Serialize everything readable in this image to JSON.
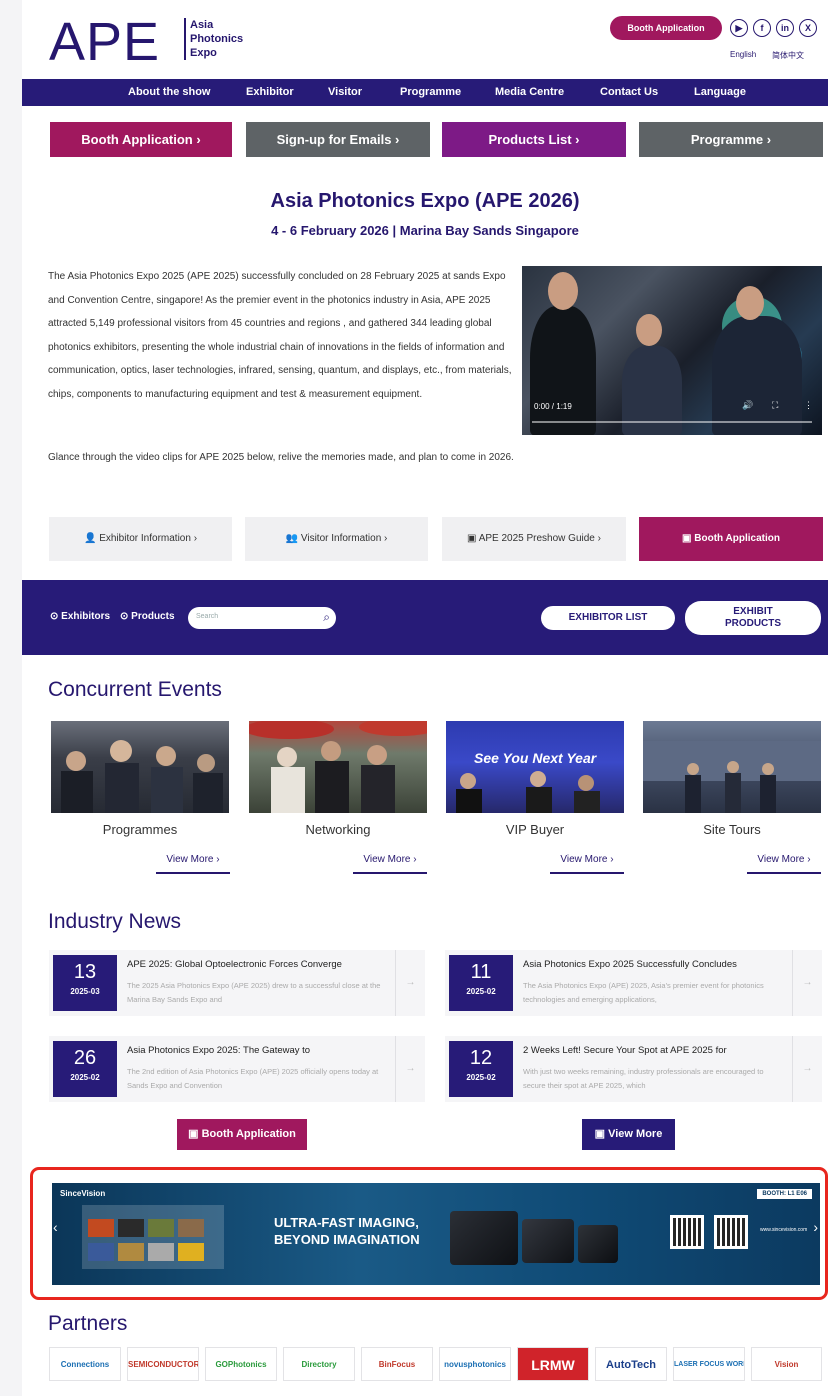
{
  "header": {
    "logo_text": "APE",
    "logo_sub": [
      "Asia",
      "Photonics",
      "Expo"
    ],
    "booth_button": "Booth Application",
    "social_icons": [
      "youtube-icon",
      "facebook-icon",
      "linkedin-icon",
      "x-icon"
    ],
    "languages": [
      "English",
      "简体中文"
    ]
  },
  "nav": [
    "About the show",
    "Exhibitor",
    "Visitor",
    "Programme",
    "Media Centre",
    "Contact Us",
    "Language"
  ],
  "quick_buttons": [
    {
      "label": "Booth Application ›",
      "color": "#a0185e"
    },
    {
      "label": "Sign-up for Emails ›",
      "color": "#5e6366"
    },
    {
      "label": "Products List ›",
      "color": "#7d1a86"
    },
    {
      "label": "Programme ›",
      "color": "#5e6366"
    }
  ],
  "hero": {
    "title": "Asia Photonics Expo (APE 2026)",
    "subtitle": "4 - 6 February 2026 | Marina Bay Sands Singapore",
    "intro": "The Asia Photonics Expo 2025 (APE 2025) successfully concluded on 28 February 2025 at sands Expo and Convention Centre, singapore! As the premier event in the photonics industry in Asia, APE 2025 attracted 5,149 professional visitors from 45 countries and regions , and gathered 344 leading global photonics exhibitors, presenting the whole industrial chain of innovations in the fields of information and communication, optics, laser technologies, infrared, sensing, quantum, and displays, etc., from materials, chips, components to manufacturing equipment and test & measurement equipment.",
    "intro2": "Glance through the video clips for APE 2025 below, relive the memories made, and plan to come in 2026.",
    "video_time": "0:00 / 1:19"
  },
  "info_buttons": [
    {
      "label": "Exhibitor Information ›",
      "icon": "person-icon"
    },
    {
      "label": "Visitor Information ›",
      "icon": "people-icon"
    },
    {
      "label": "APE 2025 Preshow Guide ›",
      "icon": "document-icon"
    },
    {
      "label": "Booth Application",
      "icon": "form-icon"
    }
  ],
  "search_band": {
    "radio_exhibitors": "Exhibitors",
    "radio_products": "Products",
    "placeholder": "Search",
    "exhibitor_list": "EXHIBITOR LIST",
    "exhibit_products": "EXHIBIT PRODUCTS"
  },
  "concurrent": {
    "title": "Concurrent Events",
    "events": [
      {
        "label": "Programmes",
        "more": "View More ›"
      },
      {
        "label": "Networking",
        "more": "View More ›"
      },
      {
        "label": "VIP Buyer",
        "more": "View More ›",
        "overlay": "See You Next Year"
      },
      {
        "label": "Site Tours",
        "more": "View More ›"
      }
    ]
  },
  "news": {
    "title": "Industry News",
    "items": [
      {
        "day": "13",
        "month": "2025-03",
        "headline": "APE 2025: Global Optoelectronic Forces Converge",
        "excerpt": "The 2025 Asia Photonics Expo (APE 2025) drew to a successful close at the Marina Bay Sands Expo and"
      },
      {
        "day": "11",
        "month": "2025-02",
        "headline": "Asia Photonics Expo 2025 Successfully Concludes",
        "excerpt": "The Asia Photonics Expo (APE) 2025, Asia's premier event for photonics technologies and emerging applications,"
      },
      {
        "day": "26",
        "month": "2025-02",
        "headline": "Asia Photonics Expo 2025: The Gateway to",
        "excerpt": "The 2nd edition of Asia Photonics Expo (APE) 2025 officially opens today at Sands Expo and Convention"
      },
      {
        "day": "12",
        "month": "2025-02",
        "headline": "2 Weeks Left! Secure Your Spot at APE 2025 for",
        "excerpt": "With just two weeks remaining, industry professionals are encouraged to secure their spot at APE 2025, which"
      }
    ],
    "booth_button": "Booth Application",
    "view_more": "View More"
  },
  "banner": {
    "brand": "SinceVision",
    "booth": "BOOTH: L1 E06",
    "headline1": "ULTRA-FAST IMAGING,",
    "headline2": "BEYOND IMAGINATION",
    "website": "www.sincevision.com"
  },
  "partners": {
    "title": "Partners",
    "logos": [
      "Connections",
      "SEMICONDUCTOR",
      "GOPhotonics",
      "Directory",
      "BinFocus",
      "novusphotonics",
      "LRMW",
      "AutoTech",
      "LASER FOCUS WORLD",
      "Vision"
    ]
  },
  "colors": {
    "navy": "#271b78",
    "magenta": "#a0185e",
    "purple": "#7d1a86",
    "gray": "#5e6366"
  }
}
